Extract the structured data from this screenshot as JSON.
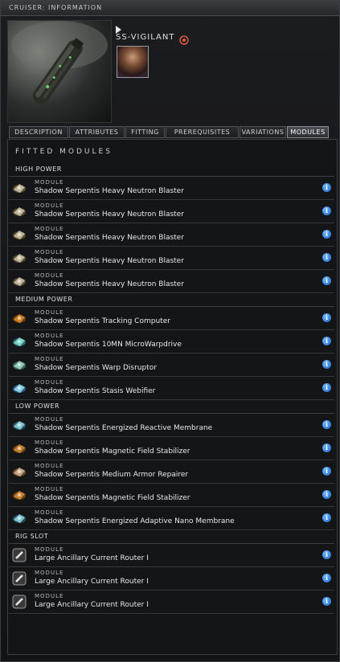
{
  "window": {
    "title": "CRUISER: INFORMATION"
  },
  "ship": {
    "name": "SS-VIGILANT"
  },
  "tabs": [
    {
      "label": "DESCRIPTION"
    },
    {
      "label": "ATTRIBUTES"
    },
    {
      "label": "FITTING"
    },
    {
      "label": "PREREQUISITES"
    },
    {
      "label": "VARIATIONS"
    },
    {
      "label": "MODULES",
      "active": true
    }
  ],
  "panel": {
    "header": "FITTED MODULES"
  },
  "sections": [
    {
      "label": "HIGH POWER",
      "items": [
        {
          "kind": "MODULE",
          "name": "Shadow Serpentis Heavy Neutron Blaster",
          "icon": "blaster-icon"
        },
        {
          "kind": "MODULE",
          "name": "Shadow Serpentis Heavy Neutron Blaster",
          "icon": "blaster-icon"
        },
        {
          "kind": "MODULE",
          "name": "Shadow Serpentis Heavy Neutron Blaster",
          "icon": "blaster-icon"
        },
        {
          "kind": "MODULE",
          "name": "Shadow Serpentis Heavy Neutron Blaster",
          "icon": "blaster-icon"
        },
        {
          "kind": "MODULE",
          "name": "Shadow Serpentis Heavy Neutron Blaster",
          "icon": "blaster-icon"
        }
      ]
    },
    {
      "label": "MEDIUM POWER",
      "items": [
        {
          "kind": "MODULE",
          "name": "Shadow Serpentis Tracking Computer",
          "icon": "tracking-computer-icon"
        },
        {
          "kind": "MODULE",
          "name": "Shadow Serpentis 10MN MicroWarpdrive",
          "icon": "microwarpdrive-icon"
        },
        {
          "kind": "MODULE",
          "name": "Shadow Serpentis Warp Disruptor",
          "icon": "warp-disruptor-icon"
        },
        {
          "kind": "MODULE",
          "name": "Shadow Serpentis Stasis Webifier",
          "icon": "stasis-webifier-icon"
        }
      ]
    },
    {
      "label": "LOW POWER",
      "items": [
        {
          "kind": "MODULE",
          "name": "Shadow Serpentis Energized Reactive Membrane",
          "icon": "membrane-icon"
        },
        {
          "kind": "MODULE",
          "name": "Shadow Serpentis Magnetic Field Stabilizer",
          "icon": "stabilizer-icon"
        },
        {
          "kind": "MODULE",
          "name": "Shadow Serpentis Medium Armor Repairer",
          "icon": "armor-repairer-icon"
        },
        {
          "kind": "MODULE",
          "name": "Shadow Serpentis Magnetic Field Stabilizer",
          "icon": "stabilizer-icon"
        },
        {
          "kind": "MODULE",
          "name": "Shadow Serpentis Energized Adaptive Nano Membrane",
          "icon": "membrane-icon"
        }
      ]
    },
    {
      "label": "RIG SLOT",
      "items": [
        {
          "kind": "MODULE",
          "name": "Large Ancillary Current Router I",
          "icon": "rig-icon"
        },
        {
          "kind": "MODULE",
          "name": "Large Ancillary Current Router I",
          "icon": "rig-icon"
        },
        {
          "kind": "MODULE",
          "name": "Large Ancillary Current Router I",
          "icon": "rig-icon"
        }
      ]
    }
  ],
  "colors": {
    "info_blue": "#2b7de0",
    "eye_orange": "#e05a3a"
  }
}
